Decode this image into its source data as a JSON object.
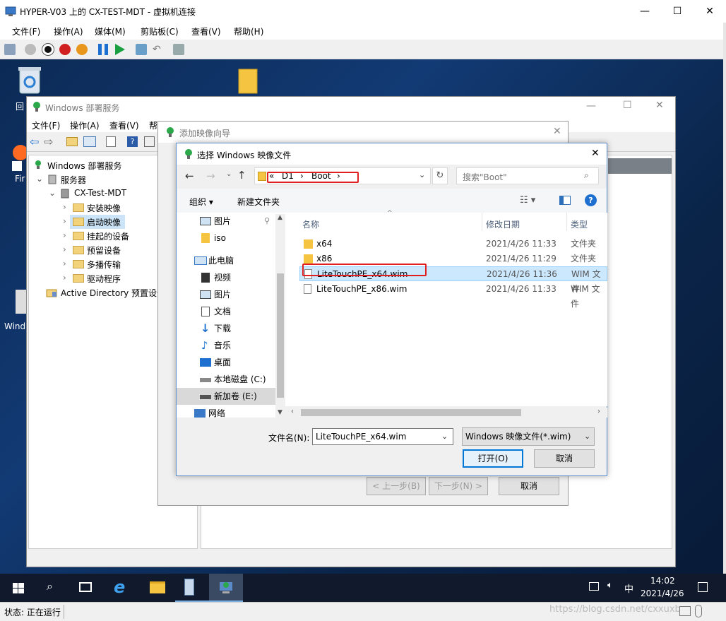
{
  "host": {
    "title": "HYPER-V03 上的 CX-TEST-MDT - 虚拟机连接",
    "menu": [
      "文件(F)",
      "操作(A)",
      "媒体(M)",
      "剪贴板(C)",
      "查看(V)",
      "帮助(H)"
    ],
    "status": "状态: 正在运行"
  },
  "desktop": {
    "icon_labels": [
      "回",
      "Fir",
      "Wind"
    ]
  },
  "wds": {
    "title": "Windows 部署服务",
    "menu": [
      "文件(F)",
      "操作(A)",
      "查看(V)",
      "帮"
    ],
    "tree": {
      "root": "Windows 部署服务",
      "servers": "服务器",
      "server": "CX-Test-MDT",
      "children": [
        "安装映像",
        "启动映像",
        "挂起的设备",
        "预留设备",
        "多播传输",
        "驱动程序"
      ],
      "ad": "Active Directory 预置设备"
    }
  },
  "wizard": {
    "title": "添加映像向导",
    "back": "< 上一步(B)",
    "next": "下一步(N) >",
    "cancel": "取消"
  },
  "dialog": {
    "title": "选择 Windows 映像文件",
    "path": [
      "«",
      "D1",
      "›",
      "Boot",
      "›"
    ],
    "search_placeholder": "搜索\"Boot\"",
    "organize": "组织",
    "new_folder": "新建文件夹",
    "nav": [
      "图片",
      "iso",
      "此电脑",
      "视频",
      "图片",
      "文档",
      "下载",
      "音乐",
      "桌面",
      "本地磁盘 (C:)",
      "新加卷 (E:)",
      "网络"
    ],
    "columns": {
      "name": "名称",
      "date": "修改日期",
      "type": "类型"
    },
    "files": [
      {
        "name": "x64",
        "date": "2021/4/26 11:33",
        "type": "文件夹"
      },
      {
        "name": "x86",
        "date": "2021/4/26 11:29",
        "type": "文件夹"
      },
      {
        "name": "LiteTouchPE_x64.wim",
        "date": "2021/4/26 11:36",
        "type": "WIM 文件"
      },
      {
        "name": "LiteTouchPE_x86.wim",
        "date": "2021/4/26 11:33",
        "type": "WIM 文件"
      }
    ],
    "filename_label": "文件名(N):",
    "filename_value": "LiteTouchPE_x64.wim",
    "filetype": "Windows 映像文件(*.wim)",
    "open": "打开(O)",
    "cancel": "取消"
  },
  "taskbar": {
    "time": "14:02",
    "date": "2021/4/26",
    "ime": "中",
    "watermark": "https://blog.csdn.net/cxxuxb"
  }
}
